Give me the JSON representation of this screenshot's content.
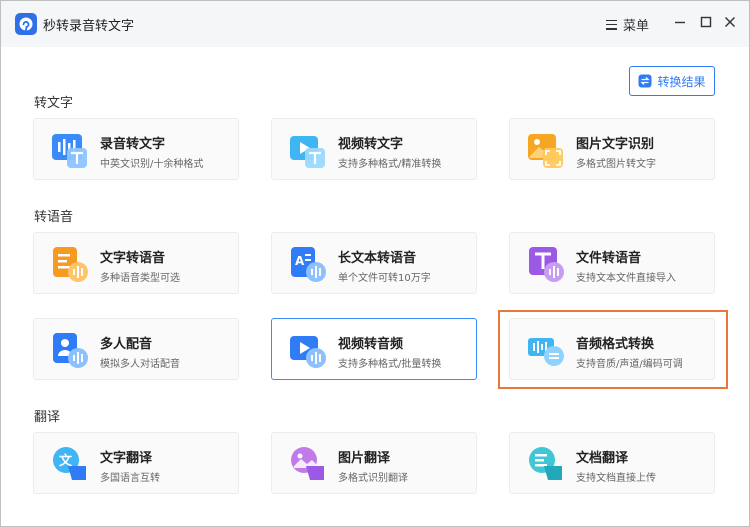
{
  "app": {
    "title": "秒转录音转文字"
  },
  "titlebar": {
    "menu_label": "菜单"
  },
  "toolbar": {
    "result_label": "转换结果"
  },
  "sections": [
    {
      "title": "转文字",
      "items": [
        {
          "name": "录音转文字",
          "desc": "中英文识别/十余种格式",
          "icon": "audio-to-text-icon"
        },
        {
          "name": "视频转文字",
          "desc": "支持多种格式/精准转换",
          "icon": "video-to-text-icon"
        },
        {
          "name": "图片文字识别",
          "desc": "多格式图片转文字",
          "icon": "image-ocr-icon"
        }
      ]
    },
    {
      "title": "转语音",
      "items": [
        {
          "name": "文字转语音",
          "desc": "多种语音类型可选",
          "icon": "text-to-speech-icon"
        },
        {
          "name": "长文本转语音",
          "desc": "单个文件可转10万字",
          "icon": "long-text-to-speech-icon"
        },
        {
          "name": "文件转语音",
          "desc": "支持文本文件直接导入",
          "icon": "file-to-speech-icon"
        },
        {
          "name": "多人配音",
          "desc": "模拟多人对话配音",
          "icon": "multi-voice-dubbing-icon"
        },
        {
          "name": "视频转音频",
          "desc": "支持多种格式/批量转换",
          "icon": "video-to-audio-icon"
        },
        {
          "name": "音频格式转换",
          "desc": "支持音质/声道/编码可调",
          "icon": "audio-format-convert-icon"
        }
      ]
    },
    {
      "title": "翻译",
      "items": [
        {
          "name": "文字翻译",
          "desc": "多国语言互转",
          "icon": "text-translate-icon"
        },
        {
          "name": "图片翻译",
          "desc": "多格式识别翻译",
          "icon": "image-translate-icon"
        },
        {
          "name": "文档翻译",
          "desc": "支持文档直接上传",
          "icon": "document-translate-icon"
        }
      ]
    }
  ],
  "colors": {
    "accent": "#2f7cf6",
    "highlight": "#e8773a",
    "titlebar": "#f5f6f8"
  }
}
